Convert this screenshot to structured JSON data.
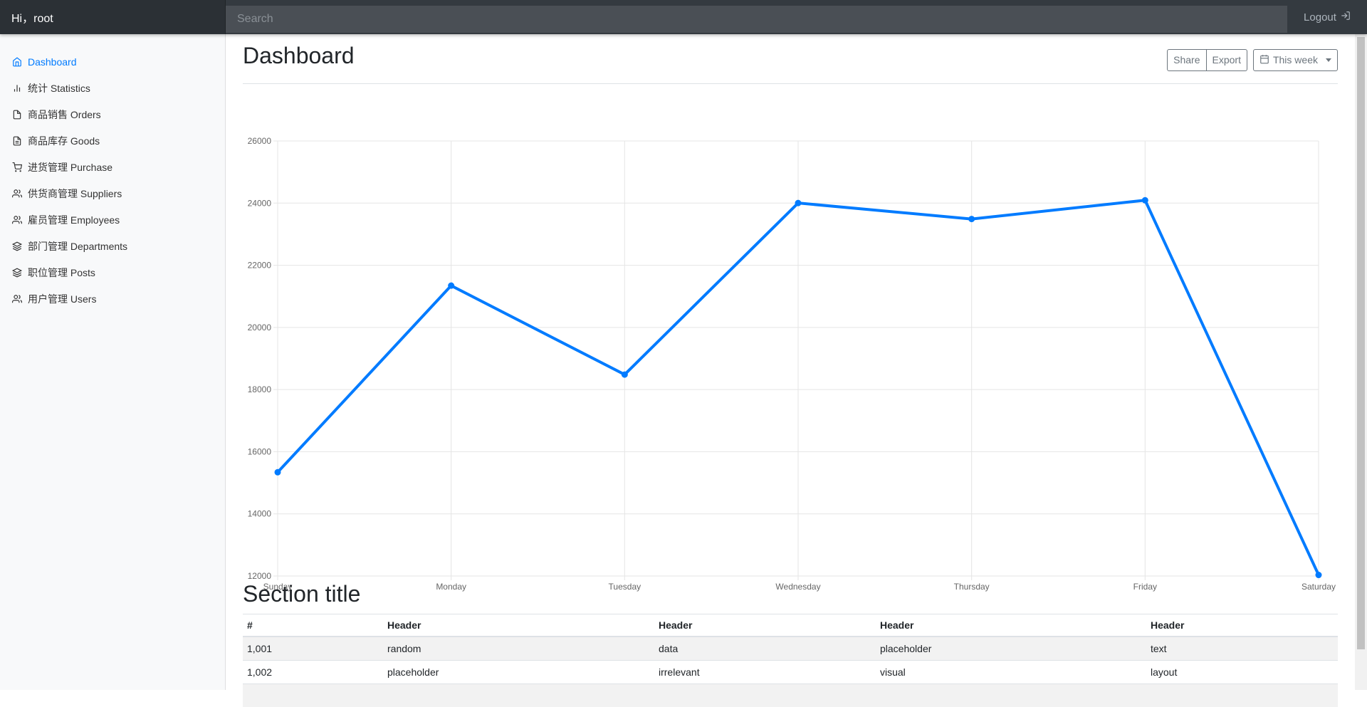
{
  "navbar": {
    "brand": "Hi，root",
    "search_placeholder": "Search",
    "logout_label": "Logout"
  },
  "sidebar": {
    "items": [
      {
        "label": "Dashboard",
        "icon": "home-icon",
        "active": true
      },
      {
        "label": "统计 Statistics",
        "icon": "bar-chart-icon"
      },
      {
        "label": "商品销售 Orders",
        "icon": "file-icon"
      },
      {
        "label": "商品库存 Goods",
        "icon": "file-text-icon"
      },
      {
        "label": "进货管理 Purchase",
        "icon": "shopping-cart-icon"
      },
      {
        "label": "供货商管理 Suppliers",
        "icon": "users-icon"
      },
      {
        "label": "雇员管理 Employees",
        "icon": "users-icon"
      },
      {
        "label": "部门管理 Departments",
        "icon": "layers-icon"
      },
      {
        "label": "职位管理 Posts",
        "icon": "layers-icon"
      },
      {
        "label": "用户管理 Users",
        "icon": "users-icon"
      }
    ]
  },
  "main": {
    "title": "Dashboard",
    "share_label": "Share",
    "export_label": "Export",
    "period_label": "This week",
    "section_title": "Section title"
  },
  "colors": {
    "accent": "#007bff",
    "navbar": "#343a40"
  },
  "chart_data": {
    "type": "line",
    "categories": [
      "Sunday",
      "Monday",
      "Tuesday",
      "Wednesday",
      "Thursday",
      "Friday",
      "Saturday"
    ],
    "series": [
      {
        "values": [
          15339,
          21345,
          18483,
          24003,
          23489,
          24092,
          12034
        ]
      }
    ],
    "ylim": [
      12000,
      26000
    ],
    "yticks": [
      12000,
      14000,
      16000,
      18000,
      20000,
      22000,
      24000,
      26000
    ],
    "grid": true,
    "legend": "none"
  },
  "table": {
    "headers": [
      "#",
      "Header",
      "Header",
      "Header",
      "Header"
    ],
    "rows": [
      [
        "1,001",
        "random",
        "data",
        "placeholder",
        "text"
      ],
      [
        "1,002",
        "placeholder",
        "irrelevant",
        "visual",
        "layout"
      ]
    ]
  }
}
